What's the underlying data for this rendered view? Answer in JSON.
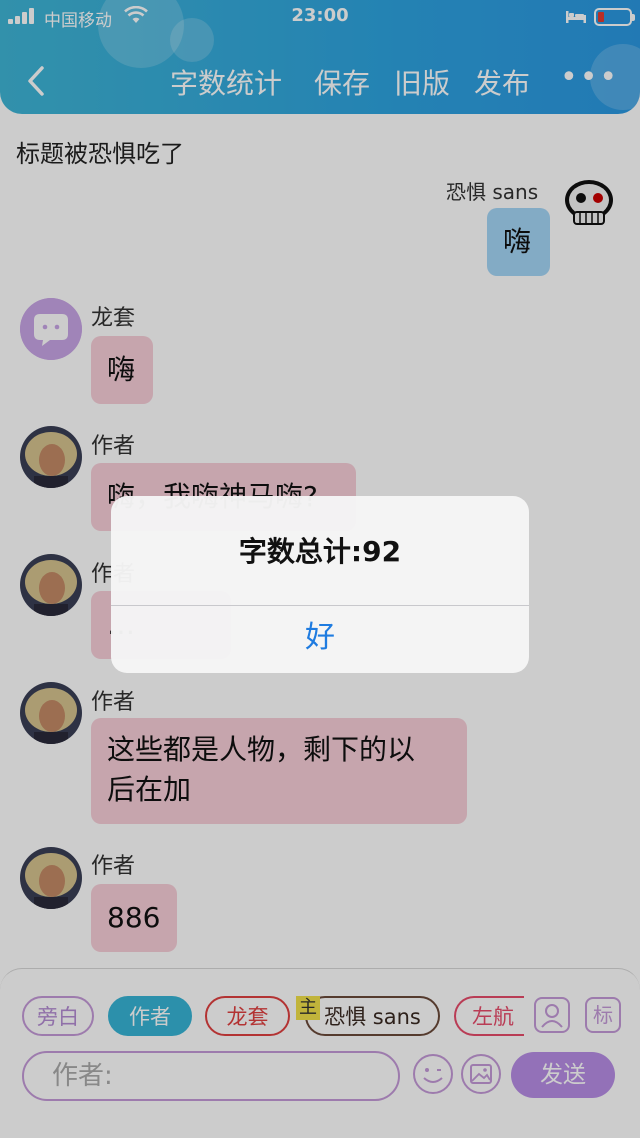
{
  "status_bar": {
    "carrier": "中国移动",
    "time": "23:00"
  },
  "nav": {
    "word_count_label": "字数统计",
    "save_label": "保存",
    "old_version_label": "旧版",
    "publish_label": "发布",
    "more_label": "•••"
  },
  "doc_title": "标题被恐惧吃了",
  "messages": [
    {
      "speaker": "恐惧 sans",
      "text": "嗨",
      "side": "right",
      "color": "blue"
    },
    {
      "speaker": "龙套",
      "text": "嗨",
      "side": "left",
      "color": "pink"
    },
    {
      "speaker": "作者",
      "text": "嗨，我嗨神马嗨?",
      "side": "left",
      "color": "pink"
    },
    {
      "speaker": "作者",
      "text": "…",
      "side": "left",
      "color": "pink"
    },
    {
      "speaker": "作者",
      "text_line1": "这些都是人物，剩下的以",
      "text_line2": "后在加",
      "side": "left",
      "color": "pink"
    },
    {
      "speaker": "作者",
      "text": "886",
      "side": "left",
      "color": "pink"
    }
  ],
  "toolbar": {
    "chips": [
      "旁白",
      "作者",
      "龙套",
      "恐惧 sans",
      "左航"
    ],
    "main_marker": "主",
    "label_btn": "标",
    "input_placeholder": "作者:",
    "send_label": "发送"
  },
  "alert": {
    "message": "字数总计:92",
    "ok_label": "好"
  },
  "colors": {
    "header": "#2ea4e0",
    "pink_bubble": "#f8cfd9",
    "blue_bubble": "#a4d6f7",
    "accent_purple": "#b88ee6",
    "alert_button": "#1e7be0"
  }
}
